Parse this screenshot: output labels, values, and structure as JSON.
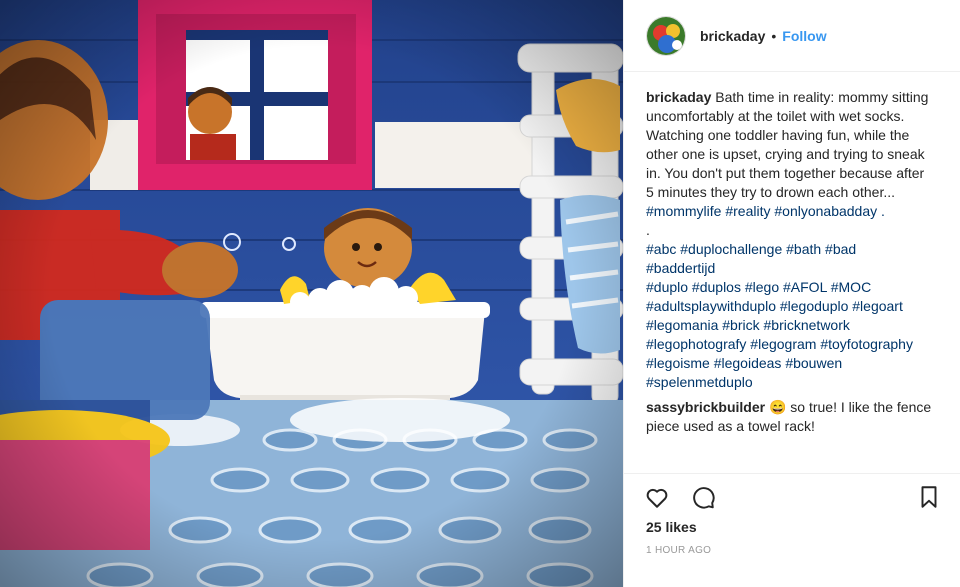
{
  "header": {
    "username": "brickaday",
    "separator": "•",
    "follow_label": "Follow"
  },
  "caption": {
    "username": "brickaday",
    "lines": [
      "Bath time in reality: mommy sitting",
      "uncomfortably at the toilet with wet socks.",
      "Watching one toddler having fun, while the",
      "other one is upset, crying and trying to sneak",
      "in. You don't put them together because after",
      "5 minutes they try to drown each other...",
      "#mommylife #reality #onlyonabadday .",
      "."
    ],
    "tags": [
      "#abc #duplochallenge #bath #bad",
      "#baddertijd",
      "#duplo #duplos #lego #AFOL #MOC",
      "#adultsplaywithduplo #legoduplo #legoart",
      "#legomania #brick #bricknetwork",
      "#legophotografy #legogram #toyfotography",
      "#legoisme #legoideas #bouwen",
      "#spelenmetduplo"
    ]
  },
  "comment": {
    "username": "sassybrickbuilder",
    "emoji": "😄",
    "line1": "so true! I like the fence",
    "line2": "piece used as a towel rack!"
  },
  "actions": {
    "icons": [
      "heart-icon",
      "comment-icon",
      "bookmark-icon"
    ],
    "likes": "25 likes",
    "timestamp": "1 HOUR AGO"
  },
  "colors": {
    "link_blue": "#3897f0",
    "hashtag_blue": "#003569",
    "text": "#262626",
    "muted": "#999999",
    "divider": "#efefef"
  }
}
